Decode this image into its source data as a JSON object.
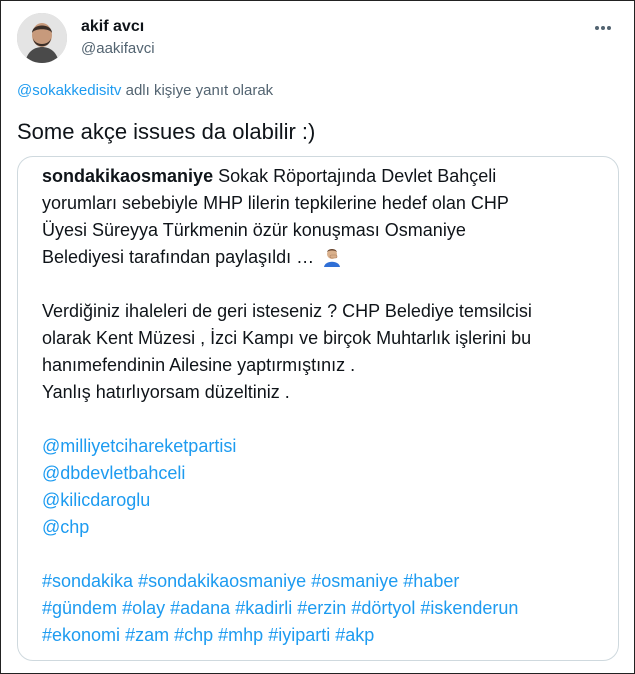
{
  "author": {
    "display_name": "akif avcı",
    "handle": "@aakifavci"
  },
  "more_icon": "more-horizontal-icon",
  "reply_context": {
    "mention": "@sokakkedisitv",
    "suffix": " adlı kişiye yanıt olarak"
  },
  "tweet_text": "Some akçe issues da olabilir :)",
  "quote": {
    "author": "sondakikaosmaniye",
    "para1_lines": [
      " Sokak Röportajında Devlet Bahçeli",
      "yorumları sebebiyle MHP lilerin tepkilerine  hedef olan  CHP",
      "Üyesi Süreyya Türkmenin özür konuşması Osmaniye",
      "Belediyesi tarafından paylaşıldı … "
    ],
    "para1_emoji": "man-facepalming-emoji",
    "para2_lines": [
      "Verdiğiniz ihaleleri de geri isteseniz ? CHP Belediye temsilcisi",
      "olarak Kent Müzesi , İzci Kampı ve birçok Muhtarlık işlerini bu",
      "hanımefendinin Ailesine yaptırmıştınız .",
      "Yanlış hatırlıyorsam düzeltiniz ."
    ],
    "mentions": [
      "@milliyetcihareketpartisi",
      "@dbdevletbahceli",
      "@kilicdaroglu",
      "@chp"
    ],
    "hashtag_lines": [
      [
        "#sondakika",
        "#sondakikaosmaniye",
        "#osmaniye",
        "#haber"
      ],
      [
        "#gündem",
        "#olay",
        "#adana",
        "#kadirli",
        "#erzin",
        "#dörtyol",
        "#iskenderun"
      ],
      [
        "#ekonomi",
        "#zam",
        "#chp",
        "#mhp",
        "#iyiparti",
        "#akp"
      ]
    ]
  },
  "colors": {
    "link": "#1d9bf0",
    "secondary_text": "#536471",
    "border": "#cfd9de"
  }
}
